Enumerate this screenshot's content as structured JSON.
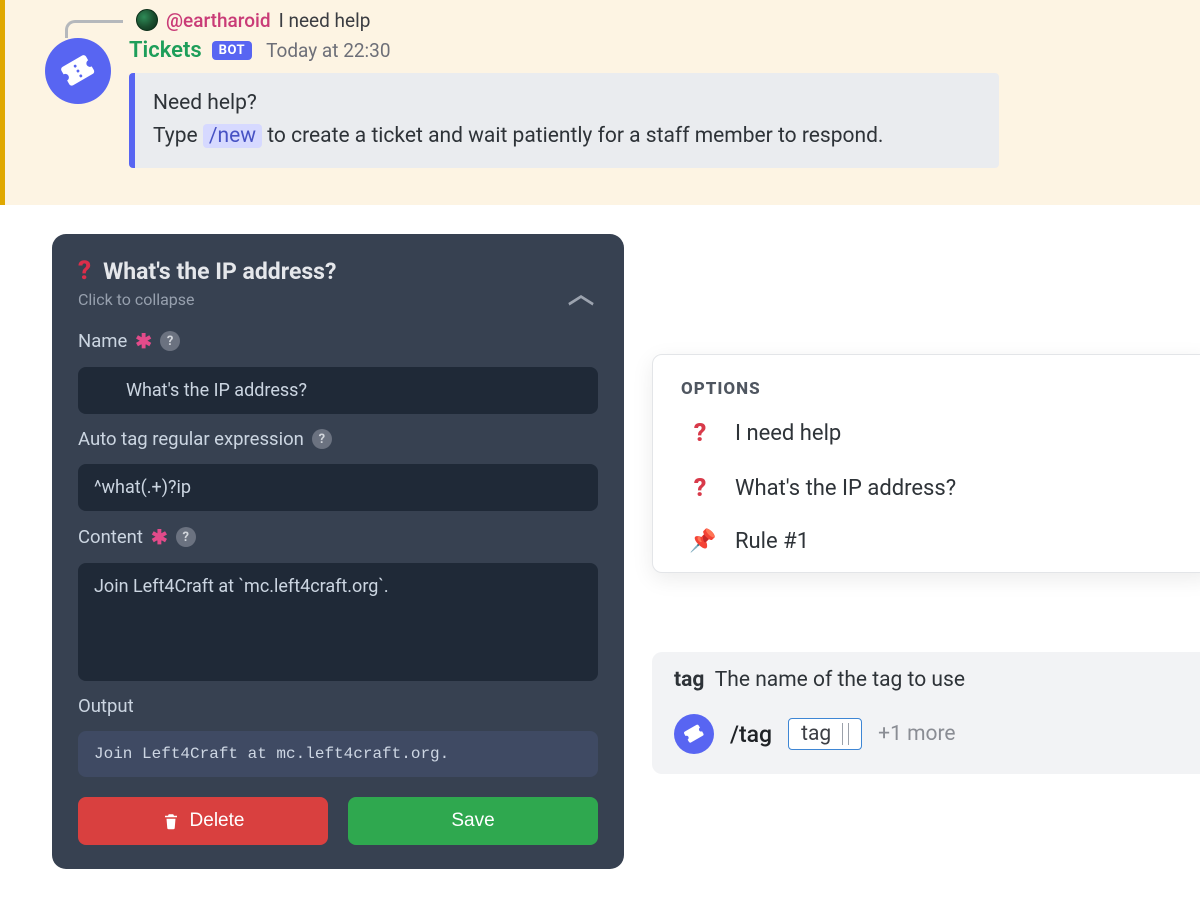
{
  "discord": {
    "reply": {
      "user": "@eartharoid",
      "text": "I need help"
    },
    "bot_name": "Tickets",
    "bot_badge": "BOT",
    "timestamp": "Today at 22:30",
    "embed_line1": "Need help?",
    "embed_line2_prefix": "Type ",
    "embed_cmd": "/new",
    "embed_line2_suffix": " to create a ticket and wait patiently for a staff member to respond."
  },
  "panel": {
    "title": "What's the IP address?",
    "subtitle": "Click to collapse",
    "labels": {
      "name": "Name",
      "regex": "Auto tag regular expression",
      "content": "Content",
      "output": "Output"
    },
    "values": {
      "name": "What's the IP address?",
      "regex": "^what(.+)?ip",
      "content": "Join Left4Craft at `mc.left4craft.org`.",
      "output": "Join Left4Craft at mc.left4craft.org."
    },
    "buttons": {
      "delete": "Delete",
      "save": "Save"
    }
  },
  "options": {
    "heading": "OPTIONS",
    "items": [
      {
        "icon": "question",
        "label": "I need help"
      },
      {
        "icon": "question",
        "label": "What's the IP address?"
      },
      {
        "icon": "pin",
        "label": "Rule #1"
      }
    ]
  },
  "command": {
    "param_name": "tag",
    "param_desc": "The name of the tag to use",
    "slash": "/tag",
    "param_value": "tag",
    "more": "+1 more"
  }
}
